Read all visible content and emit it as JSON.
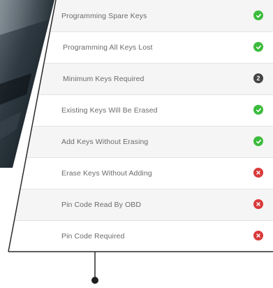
{
  "features": [
    {
      "label": "Programming Spare Keys",
      "status": "yes",
      "status_text": ""
    },
    {
      "label": "Programming All Keys Lost",
      "status": "yes",
      "status_text": ""
    },
    {
      "label": "Minimum Keys Required",
      "status": "num",
      "status_text": "2"
    },
    {
      "label": "Existing Keys Will Be Erased",
      "status": "yes",
      "status_text": ""
    },
    {
      "label": "Add Keys Without Erasing",
      "status": "yes",
      "status_text": ""
    },
    {
      "label": "Erase Keys Without Adding",
      "status": "no",
      "status_text": ""
    },
    {
      "label": "Pin Code Read By OBD",
      "status": "no",
      "status_text": ""
    },
    {
      "label": "Pin Code Required",
      "status": "no",
      "status_text": ""
    }
  ],
  "colors": {
    "yes": "#3dbb3d",
    "no": "#d93a3a",
    "num": "#444444",
    "frame_line": "#2a2a2a"
  },
  "icons": {
    "yes": "check-circle-icon",
    "no": "x-circle-icon",
    "num": "number-badge-icon"
  }
}
